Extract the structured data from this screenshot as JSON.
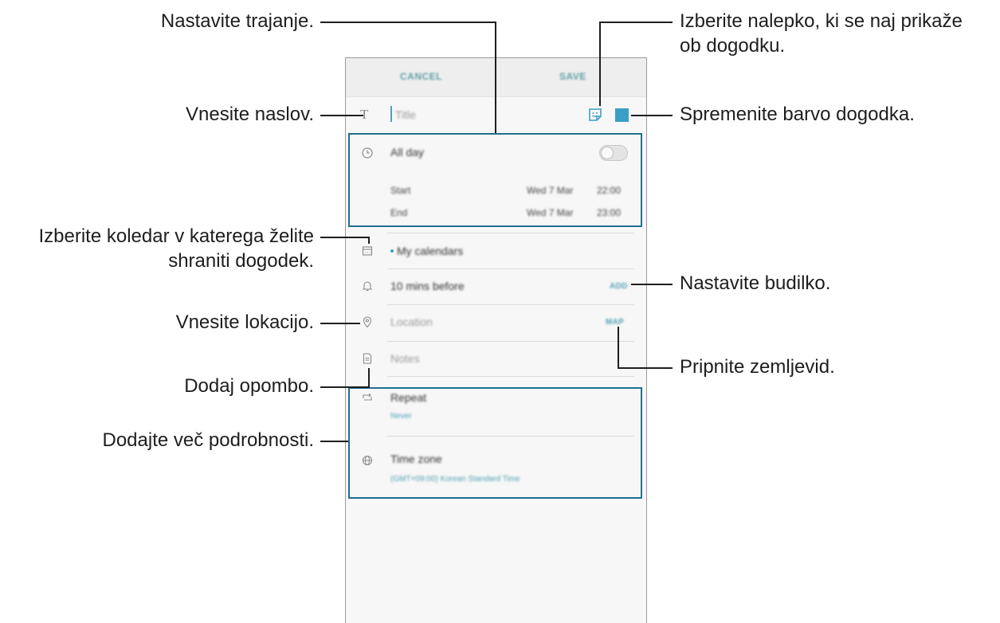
{
  "appbar": {
    "cancel": "CANCEL",
    "save": "SAVE"
  },
  "title_field": {
    "placeholder": "Title"
  },
  "all_day": {
    "label": "All day",
    "checked": false
  },
  "start": {
    "label": "Start",
    "date": "Wed 7 Mar",
    "time": "22:00"
  },
  "end": {
    "label": "End",
    "date": "Wed 7 Mar",
    "time": "23:00"
  },
  "calendar": {
    "value": "My calendars"
  },
  "reminder": {
    "value": "10 mins before",
    "action": "ADD"
  },
  "location": {
    "placeholder": "Location",
    "action": "MAP"
  },
  "notes": {
    "placeholder": "Notes"
  },
  "repeat": {
    "label": "Repeat",
    "value": "Never"
  },
  "timezone": {
    "label": "Time zone",
    "value": "(GMT+09:00) Korean Standard Time"
  },
  "colors": {
    "event_color": "#3aa0c5",
    "accent": "#4f9fb3",
    "highlight_box": "#1f6f8f"
  },
  "icons": {
    "title": "text-icon",
    "sticker": "sticker-icon",
    "clock": "clock-icon",
    "calendar": "calendar-icon",
    "bell": "bell-icon",
    "location": "location-pin-icon",
    "notes": "notes-icon",
    "repeat": "repeat-icon",
    "timezone": "globe-icon"
  },
  "annotations": {
    "duration": "Nastavite trajanje.",
    "title": "Vnesite naslov.",
    "calendar_line1": "Izberite koledar v katerega želite",
    "calendar_line2": "shraniti dogodek.",
    "location": "Vnesite lokacijo.",
    "note": "Dodaj opombo.",
    "details": "Dodajte več podrobnosti.",
    "sticker_line1": "Izberite nalepko, ki se naj prikaže",
    "sticker_line2": "ob dogodku.",
    "color": "Spremenite barvo dogodka.",
    "alarm": "Nastavite budilko.",
    "map": "Pripnite zemljevid."
  }
}
